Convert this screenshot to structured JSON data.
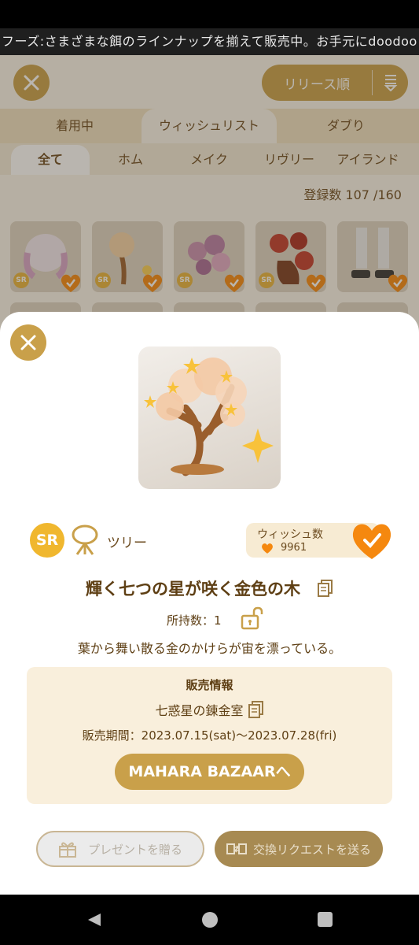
{
  "ticker": {
    "text": "フーズ:さまざまな餌のラインナップを揃えて販売中。お手元にdoodoo"
  },
  "header": {
    "sort_label": "リリース順"
  },
  "tabs": [
    {
      "label": "着用中",
      "active": false
    },
    {
      "label": "ウィッシュリスト",
      "active": true
    },
    {
      "label": "ダブり",
      "active": false
    }
  ],
  "subtabs": [
    {
      "label": "全て",
      "active": true
    },
    {
      "label": "ホム",
      "active": false
    },
    {
      "label": "メイク",
      "active": false
    },
    {
      "label": "リヴリー",
      "active": false
    },
    {
      "label": "アイランド",
      "active": false
    }
  ],
  "count": {
    "label": "登録数 107 /160"
  },
  "grid": {
    "items": [
      {
        "rarity": "SR",
        "checked": true
      },
      {
        "rarity": "SR",
        "checked": true
      },
      {
        "rarity": "SR",
        "checked": true
      },
      {
        "rarity": "SR",
        "checked": true
      },
      {
        "rarity": "",
        "checked": true
      }
    ]
  },
  "detail": {
    "rarity": "SR",
    "type_label": "ツリー",
    "wish_label": "ウィッシュ数",
    "wish_count": "9961",
    "title": "輝く七つの星が咲く金色の木",
    "owned": "所持数：1",
    "description": "葉から舞い散る金のかけらが宙を漂っている。",
    "sales": {
      "heading": "販売情報",
      "shop": "七惑星の錬金室",
      "period": "販売期間：2023.07.15(sat)〜2023.07.28(fri)",
      "button": "MAHARA BAZAARへ"
    },
    "present_button": "プレゼントを贈る",
    "trade_button": "交換リクエストを送る"
  },
  "colors": {
    "accent": "#c9a04a",
    "heart": "#f5880f",
    "brown": "#6b4a1e"
  }
}
